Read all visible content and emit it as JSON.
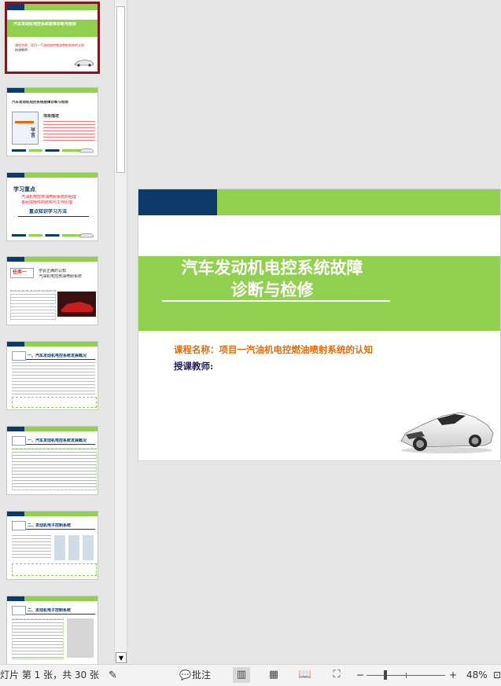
{
  "thumbnails": [
    {
      "title": "汽车发动机电控系统故障诊断与检修",
      "lines": [
        "课程名称：项目一汽油机电控燃油喷射系统的认知",
        "授课教师："
      ]
    },
    {
      "title": "汽车发动机电控系统故障诊断与检修",
      "heading": "项目描述",
      "sidebox": "导言"
    },
    {
      "title": "学习重点",
      "lines": [
        "汽油机电控燃油喷射系统的组成",
        "各组成部件的结构与工作原理"
      ],
      "subtitle": "重点知识学习方法"
    },
    {
      "title": "任务一",
      "lines": [
        "学会正确的认知",
        "汽油机电控燃油喷射系统"
      ]
    },
    {
      "title": "一、汽车发动机电控系统发展概况"
    },
    {
      "title": "一、汽车发动机电控系统发展概况"
    },
    {
      "title": "二、发动机电子控制系统"
    },
    {
      "title": "二、发动机电子控制系统"
    }
  ],
  "slide": {
    "title_line1": "汽车发动机电控系统故障",
    "title_line2": "诊断与检修",
    "course_label": "课程名称：项目一汽油机电控燃油喷射系统的认知",
    "teacher_label": "授课教师:"
  },
  "statusbar": {
    "slide_info": "灯片 第 1 张，共 30 张",
    "comments_label": "批注",
    "zoom_minus": "−",
    "zoom_plus": "+",
    "zoom_level": "48%"
  },
  "colors": {
    "green": "#92d050",
    "navy": "#0e3a6b",
    "orange": "#e36c09",
    "selected_border": "#7b1a20"
  }
}
